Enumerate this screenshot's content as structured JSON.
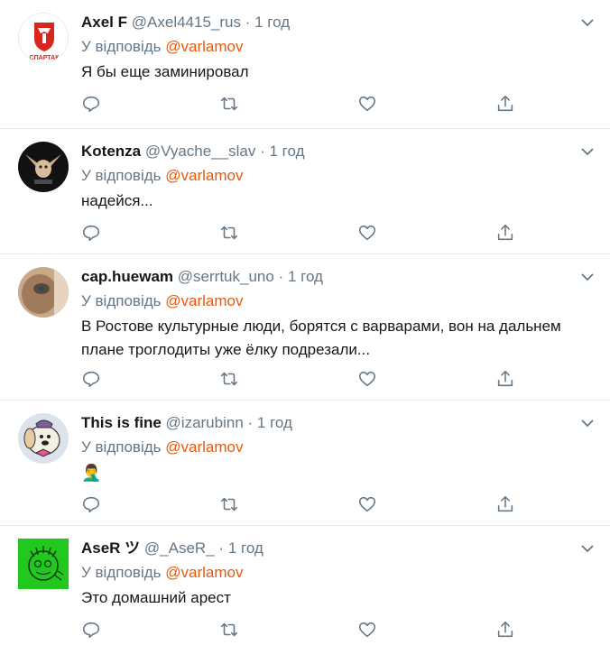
{
  "tweets": [
    {
      "name": "Axel F",
      "handle": "@Axel4415_rus",
      "dot": "·",
      "time": "1 год",
      "reply_prefix": "У відповідь",
      "reply_to": "@varlamov",
      "text": "Я бы еще заминировал",
      "avatar_icon": "spartak-logo-avatar",
      "avatar_text": "СПАРТАК"
    },
    {
      "name": "Kotenza",
      "handle": "@Vyache__slav",
      "dot": "·",
      "time": "1 год",
      "reply_prefix": "У відповідь",
      "reply_to": "@varlamov",
      "text": "надейся...",
      "avatar_icon": "bat-eared-creature-avatar"
    },
    {
      "name": "cap.huewam",
      "handle": "@serrtuk_uno",
      "dot": "·",
      "time": "1 год",
      "reply_prefix": "У відповідь",
      "reply_to": "@varlamov",
      "text": "В Ростове культурные люди, борятся с варварами, вон на дальнем плане троглодиты уже ёлку подрезали...",
      "avatar_icon": "photo-avatar"
    },
    {
      "name": "This is fine",
      "handle": "@izarubinn",
      "dot": "·",
      "time": "1 год",
      "reply_prefix": "У відповідь",
      "reply_to": "@varlamov",
      "text": "🤦‍♂️",
      "avatar_icon": "cartoon-dog-avatar"
    },
    {
      "name": "AseR ツ",
      "handle": "@_AseR_",
      "dot": "·",
      "time": "1 год",
      "reply_prefix": "У відповідь",
      "reply_to": "@varlamov",
      "text": "Это домашний арест",
      "avatar_icon": "green-doodle-avatar"
    }
  ],
  "colors": {
    "accent": "#e8590c",
    "secondary_text": "#657786",
    "icon": "#657786",
    "divider": "#e6ecf0"
  },
  "action_icons": [
    "reply-icon",
    "retweet-icon",
    "like-icon",
    "share-icon"
  ]
}
